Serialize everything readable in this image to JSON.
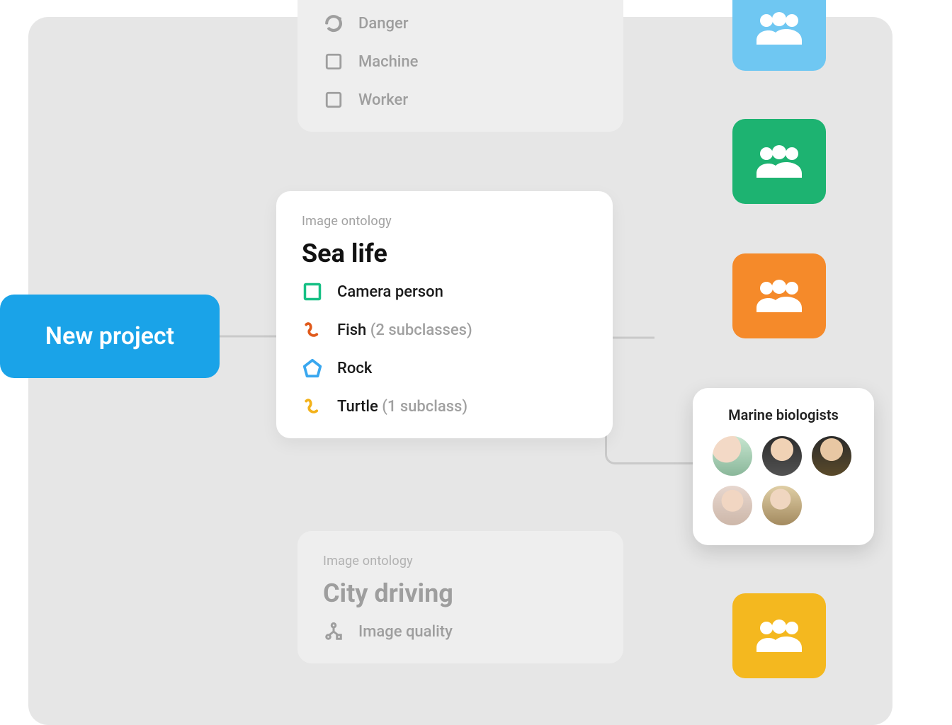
{
  "new_project_label": "New project",
  "cards": {
    "top": {
      "items": [
        {
          "icon": "refresh-icon",
          "label": "Danger"
        },
        {
          "icon": "square-icon",
          "label": "Machine"
        },
        {
          "icon": "square-icon",
          "label": "Worker"
        }
      ]
    },
    "focus": {
      "eyebrow": "Image ontology",
      "title": "Sea life",
      "items": [
        {
          "icon": "square-green-icon",
          "label": "Camera person",
          "sub": ""
        },
        {
          "icon": "squiggle-orange-icon",
          "label": "Fish",
          "sub": "(2 subclasses)"
        },
        {
          "icon": "pentagon-blue-icon",
          "label": "Rock",
          "sub": ""
        },
        {
          "icon": "squiggle-yellow-icon",
          "label": "Turtle",
          "sub": "(1 subclass)"
        }
      ]
    },
    "bottom": {
      "eyebrow": "Image ontology",
      "title": "City driving",
      "items": [
        {
          "icon": "tree-icon",
          "label": "Image quality"
        }
      ]
    }
  },
  "team_tiles": [
    {
      "color": "#6fc7f2"
    },
    {
      "color": "#1db371"
    },
    {
      "color": "#f58a2a"
    },
    {
      "color": "#f4b81f"
    }
  ],
  "team_card": {
    "label": "Marine biologists",
    "avatar_count": 5
  }
}
